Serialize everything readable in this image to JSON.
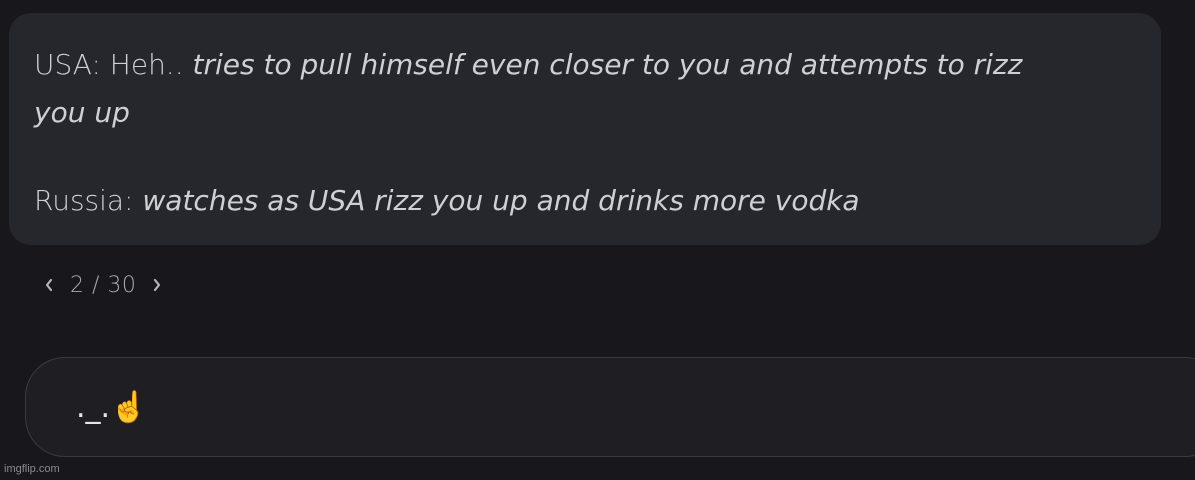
{
  "message": {
    "line1_speaker": "USA: Heh.. ",
    "line1_action": "tries to pull himself even closer to you and attempts to rizz",
    "line1_action_cont": "you up",
    "line2_speaker": "Russia: ",
    "line2_action": "watches as USA rizz you up and drinks more vodka"
  },
  "pager": {
    "count": "2 / 30",
    "prev_icon": "chevron-left-icon",
    "next_icon": "chevron-right-icon"
  },
  "composer": {
    "value": "._.☝️"
  },
  "watermark": {
    "text": "imgflip.com"
  },
  "colors": {
    "background": "#18181c",
    "bubble": "#26272c",
    "text": "#cfcfd4",
    "muted": "#a9a9ae"
  }
}
